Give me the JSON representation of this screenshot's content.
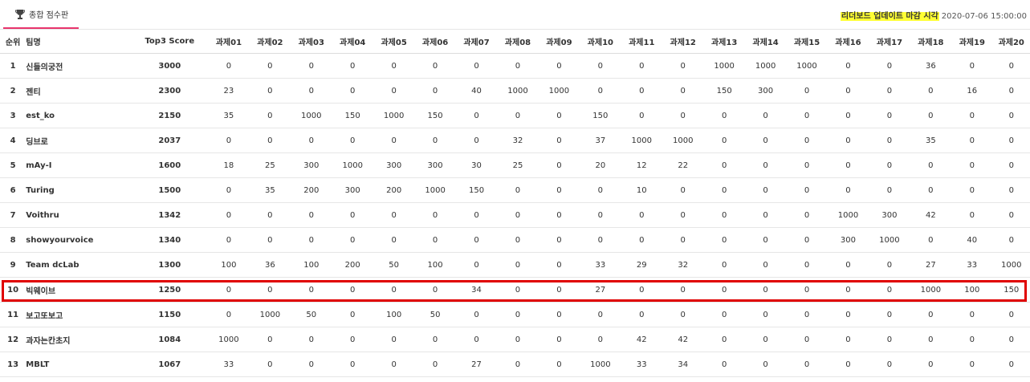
{
  "tab": {
    "label": "종합 점수판",
    "icon": "trophy-icon"
  },
  "deadline": {
    "label": "리더보드 업데이트 마감 시각",
    "value": "2020-07-06 15:00:00",
    "highlight_color": "#ffff33"
  },
  "table": {
    "headers": [
      "순위",
      "팀명",
      "Top3 Score",
      "과제01",
      "과제02",
      "과제03",
      "과제04",
      "과제05",
      "과제06",
      "과제07",
      "과제08",
      "과제09",
      "과제10",
      "과제11",
      "과제12",
      "과제13",
      "과제14",
      "과제15",
      "과제16",
      "과제17",
      "과제18",
      "과제19",
      "과제20"
    ],
    "rows": [
      [
        "1",
        "신들의궁전",
        "3000",
        "0",
        "0",
        "0",
        "0",
        "0",
        "0",
        "0",
        "0",
        "0",
        "0",
        "0",
        "0",
        "1000",
        "1000",
        "1000",
        "0",
        "0",
        "36",
        "0",
        "0"
      ],
      [
        "2",
        "젠티",
        "2300",
        "23",
        "0",
        "0",
        "0",
        "0",
        "0",
        "40",
        "1000",
        "1000",
        "0",
        "0",
        "0",
        "150",
        "300",
        "0",
        "0",
        "0",
        "0",
        "16",
        "0"
      ],
      [
        "3",
        "est_ko",
        "2150",
        "35",
        "0",
        "1000",
        "150",
        "1000",
        "150",
        "0",
        "0",
        "0",
        "150",
        "0",
        "0",
        "0",
        "0",
        "0",
        "0",
        "0",
        "0",
        "0",
        "0"
      ],
      [
        "4",
        "딩브로",
        "2037",
        "0",
        "0",
        "0",
        "0",
        "0",
        "0",
        "0",
        "32",
        "0",
        "37",
        "1000",
        "1000",
        "0",
        "0",
        "0",
        "0",
        "0",
        "35",
        "0",
        "0"
      ],
      [
        "5",
        "mAy-I",
        "1600",
        "18",
        "25",
        "300",
        "1000",
        "300",
        "300",
        "30",
        "25",
        "0",
        "20",
        "12",
        "22",
        "0",
        "0",
        "0",
        "0",
        "0",
        "0",
        "0",
        "0"
      ],
      [
        "6",
        "Turing",
        "1500",
        "0",
        "35",
        "200",
        "300",
        "200",
        "1000",
        "150",
        "0",
        "0",
        "0",
        "10",
        "0",
        "0",
        "0",
        "0",
        "0",
        "0",
        "0",
        "0",
        "0"
      ],
      [
        "7",
        "Voithru",
        "1342",
        "0",
        "0",
        "0",
        "0",
        "0",
        "0",
        "0",
        "0",
        "0",
        "0",
        "0",
        "0",
        "0",
        "0",
        "0",
        "1000",
        "300",
        "42",
        "0",
        "0"
      ],
      [
        "8",
        "showyourvoice",
        "1340",
        "0",
        "0",
        "0",
        "0",
        "0",
        "0",
        "0",
        "0",
        "0",
        "0",
        "0",
        "0",
        "0",
        "0",
        "0",
        "300",
        "1000",
        "0",
        "40",
        "0"
      ],
      [
        "9",
        "Team dcLab",
        "1300",
        "100",
        "36",
        "100",
        "200",
        "50",
        "100",
        "0",
        "0",
        "0",
        "33",
        "29",
        "32",
        "0",
        "0",
        "0",
        "0",
        "0",
        "27",
        "33",
        "1000"
      ],
      [
        "10",
        "빅웨이브",
        "1250",
        "0",
        "0",
        "0",
        "0",
        "0",
        "0",
        "34",
        "0",
        "0",
        "27",
        "0",
        "0",
        "0",
        "0",
        "0",
        "0",
        "0",
        "1000",
        "100",
        "150"
      ],
      [
        "11",
        "보고또보고",
        "1150",
        "0",
        "1000",
        "50",
        "0",
        "100",
        "50",
        "0",
        "0",
        "0",
        "0",
        "0",
        "0",
        "0",
        "0",
        "0",
        "0",
        "0",
        "0",
        "0",
        "0"
      ],
      [
        "12",
        "과자는칸초지",
        "1084",
        "1000",
        "0",
        "0",
        "0",
        "0",
        "0",
        "0",
        "0",
        "0",
        "0",
        "42",
        "42",
        "0",
        "0",
        "0",
        "0",
        "0",
        "0",
        "0",
        "0"
      ],
      [
        "13",
        "MBLT",
        "1067",
        "33",
        "0",
        "0",
        "0",
        "0",
        "0",
        "27",
        "0",
        "0",
        "1000",
        "33",
        "34",
        "0",
        "0",
        "0",
        "0",
        "0",
        "0",
        "0",
        "0"
      ]
    ]
  },
  "colors": {
    "tab_underline": "#e8346c",
    "highlight_border": "#e00000"
  }
}
